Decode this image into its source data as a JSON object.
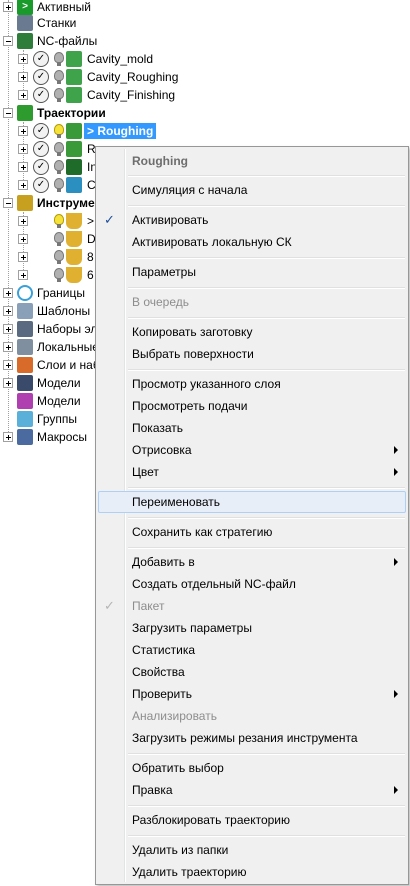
{
  "tree": {
    "active_label": "Активный",
    "machines_label": "Станки",
    "nc_files": {
      "label": "NC-файлы",
      "items": [
        "Cavity_mold",
        "Cavity_Roughing",
        "Cavity_Finishing"
      ]
    },
    "toolpaths": {
      "label": "Траектории",
      "selected": "> Roughing",
      "items": [
        "R",
        "In",
        "C"
      ]
    },
    "tools": {
      "label": "Инструмен",
      "items": [
        ">",
        "D",
        "8",
        "6"
      ]
    },
    "boundaries_label": "Границы",
    "patterns_label": "Шаблоны",
    "feature_sets_label": "Наборы эл",
    "local_cs_label": "Локальные",
    "levels_label": "Слои и наб",
    "models_label_1": "Модели",
    "models_label_2": "Модели",
    "groups_label": "Группы",
    "macros_label": "Макросы"
  },
  "menu": {
    "header": "Roughing",
    "items": {
      "simulate": "Симуляция с начала",
      "activate": "Активировать",
      "activate_local_cs": "Активировать локальную СК",
      "parameters": "Параметры",
      "queue": "В очередь",
      "copy_stock": "Копировать заготовку",
      "select_surfaces": "Выбрать поверхности",
      "view_layer": "Просмотр указанного слоя",
      "view_feeds": "Просмотреть подачи",
      "show": "Показать",
      "drawing": "Отрисовка",
      "color": "Цвет",
      "rename": "Переименовать",
      "save_strategy": "Сохранить как стратегию",
      "add_to": "Добавить в",
      "create_nc": "Создать отдельный NC-файл",
      "batch": "Пакет",
      "load_params": "Загрузить параметры",
      "statistics": "Статистика",
      "properties": "Свойства",
      "verify": "Проверить",
      "analyze": "Анализировать",
      "load_cutting": "Загрузить режимы резания инструмента",
      "invert_selection": "Обратить выбор",
      "edit": "Правка",
      "unlock": "Разблокировать траекторию",
      "delete_from_folder": "Удалить из папки",
      "delete_toolpath": "Удалить траекторию"
    },
    "check_mark": "✓"
  },
  "colors": {
    "selection": "#3399ff",
    "menu_bg": "#f0f0f0",
    "hover_bg": "#e7eef8",
    "hover_border": "#aecff7"
  }
}
